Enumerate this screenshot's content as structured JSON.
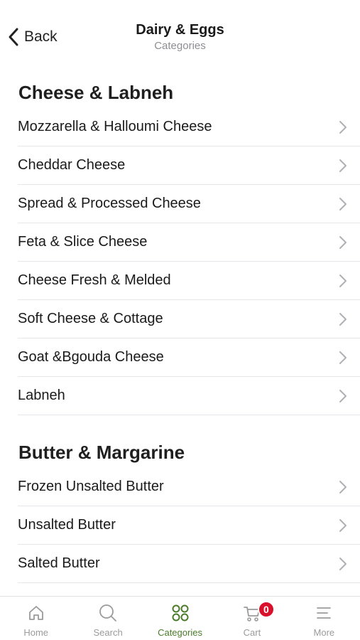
{
  "header": {
    "back_label": "Back",
    "title": "Dairy & Eggs",
    "subtitle": "Categories"
  },
  "sections": [
    {
      "title": "Cheese & Labneh",
      "items": [
        {
          "label": "Mozzarella & Halloumi Cheese"
        },
        {
          "label": "Cheddar Cheese"
        },
        {
          "label": "Spread & Processed Cheese"
        },
        {
          "label": "Feta & Slice Cheese"
        },
        {
          "label": "Cheese Fresh & Melded"
        },
        {
          "label": "Soft Cheese & Cottage"
        },
        {
          "label": "Goat &Bgouda Cheese"
        },
        {
          "label": "Labneh"
        }
      ]
    },
    {
      "title": "Butter & Margarine",
      "items": [
        {
          "label": "Frozen Unsalted Butter"
        },
        {
          "label": "Unsalted Butter"
        },
        {
          "label": "Salted Butter"
        }
      ]
    }
  ],
  "tabbar": {
    "tabs": [
      {
        "label": "Home",
        "icon": "home-icon"
      },
      {
        "label": "Search",
        "icon": "search-icon"
      },
      {
        "label": "Categories",
        "icon": "categories-icon",
        "active": true
      },
      {
        "label": "Cart",
        "icon": "cart-icon",
        "badge": "0"
      },
      {
        "label": "More",
        "icon": "menu-icon"
      }
    ],
    "active_color": "#4a7c2a",
    "inactive_color": "#9b9b9b",
    "badge_color": "#d8102b"
  }
}
